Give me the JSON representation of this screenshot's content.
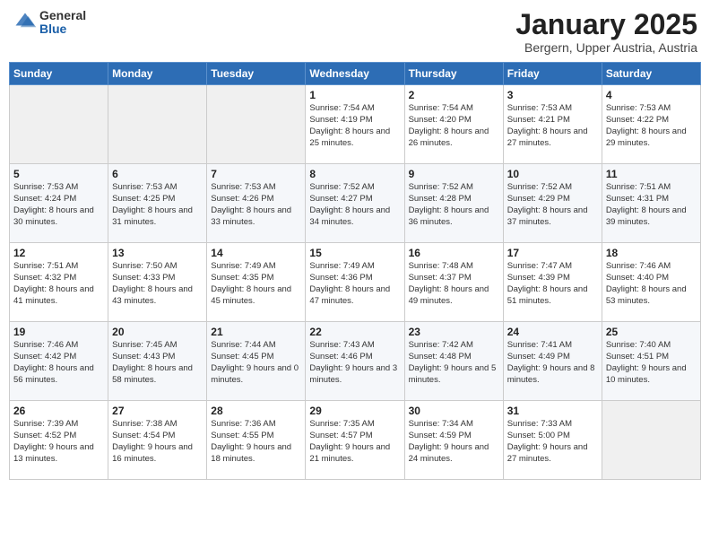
{
  "logo": {
    "general": "General",
    "blue": "Blue"
  },
  "title": "January 2025",
  "subtitle": "Bergern, Upper Austria, Austria",
  "days_header": [
    "Sunday",
    "Monday",
    "Tuesday",
    "Wednesday",
    "Thursday",
    "Friday",
    "Saturday"
  ],
  "weeks": [
    [
      {
        "day": "",
        "empty": true
      },
      {
        "day": "",
        "empty": true
      },
      {
        "day": "",
        "empty": true
      },
      {
        "day": "1",
        "sunrise": "7:54 AM",
        "sunset": "4:19 PM",
        "daylight": "8 hours and 25 minutes."
      },
      {
        "day": "2",
        "sunrise": "7:54 AM",
        "sunset": "4:20 PM",
        "daylight": "8 hours and 26 minutes."
      },
      {
        "day": "3",
        "sunrise": "7:53 AM",
        "sunset": "4:21 PM",
        "daylight": "8 hours and 27 minutes."
      },
      {
        "day": "4",
        "sunrise": "7:53 AM",
        "sunset": "4:22 PM",
        "daylight": "8 hours and 29 minutes."
      }
    ],
    [
      {
        "day": "5",
        "sunrise": "7:53 AM",
        "sunset": "4:24 PM",
        "daylight": "8 hours and 30 minutes."
      },
      {
        "day": "6",
        "sunrise": "7:53 AM",
        "sunset": "4:25 PM",
        "daylight": "8 hours and 31 minutes."
      },
      {
        "day": "7",
        "sunrise": "7:53 AM",
        "sunset": "4:26 PM",
        "daylight": "8 hours and 33 minutes."
      },
      {
        "day": "8",
        "sunrise": "7:52 AM",
        "sunset": "4:27 PM",
        "daylight": "8 hours and 34 minutes."
      },
      {
        "day": "9",
        "sunrise": "7:52 AM",
        "sunset": "4:28 PM",
        "daylight": "8 hours and 36 minutes."
      },
      {
        "day": "10",
        "sunrise": "7:52 AM",
        "sunset": "4:29 PM",
        "daylight": "8 hours and 37 minutes."
      },
      {
        "day": "11",
        "sunrise": "7:51 AM",
        "sunset": "4:31 PM",
        "daylight": "8 hours and 39 minutes."
      }
    ],
    [
      {
        "day": "12",
        "sunrise": "7:51 AM",
        "sunset": "4:32 PM",
        "daylight": "8 hours and 41 minutes."
      },
      {
        "day": "13",
        "sunrise": "7:50 AM",
        "sunset": "4:33 PM",
        "daylight": "8 hours and 43 minutes."
      },
      {
        "day": "14",
        "sunrise": "7:49 AM",
        "sunset": "4:35 PM",
        "daylight": "8 hours and 45 minutes."
      },
      {
        "day": "15",
        "sunrise": "7:49 AM",
        "sunset": "4:36 PM",
        "daylight": "8 hours and 47 minutes."
      },
      {
        "day": "16",
        "sunrise": "7:48 AM",
        "sunset": "4:37 PM",
        "daylight": "8 hours and 49 minutes."
      },
      {
        "day": "17",
        "sunrise": "7:47 AM",
        "sunset": "4:39 PM",
        "daylight": "8 hours and 51 minutes."
      },
      {
        "day": "18",
        "sunrise": "7:46 AM",
        "sunset": "4:40 PM",
        "daylight": "8 hours and 53 minutes."
      }
    ],
    [
      {
        "day": "19",
        "sunrise": "7:46 AM",
        "sunset": "4:42 PM",
        "daylight": "8 hours and 56 minutes."
      },
      {
        "day": "20",
        "sunrise": "7:45 AM",
        "sunset": "4:43 PM",
        "daylight": "8 hours and 58 minutes."
      },
      {
        "day": "21",
        "sunrise": "7:44 AM",
        "sunset": "4:45 PM",
        "daylight": "9 hours and 0 minutes."
      },
      {
        "day": "22",
        "sunrise": "7:43 AM",
        "sunset": "4:46 PM",
        "daylight": "9 hours and 3 minutes."
      },
      {
        "day": "23",
        "sunrise": "7:42 AM",
        "sunset": "4:48 PM",
        "daylight": "9 hours and 5 minutes."
      },
      {
        "day": "24",
        "sunrise": "7:41 AM",
        "sunset": "4:49 PM",
        "daylight": "9 hours and 8 minutes."
      },
      {
        "day": "25",
        "sunrise": "7:40 AM",
        "sunset": "4:51 PM",
        "daylight": "9 hours and 10 minutes."
      }
    ],
    [
      {
        "day": "26",
        "sunrise": "7:39 AM",
        "sunset": "4:52 PM",
        "daylight": "9 hours and 13 minutes."
      },
      {
        "day": "27",
        "sunrise": "7:38 AM",
        "sunset": "4:54 PM",
        "daylight": "9 hours and 16 minutes."
      },
      {
        "day": "28",
        "sunrise": "7:36 AM",
        "sunset": "4:55 PM",
        "daylight": "9 hours and 18 minutes."
      },
      {
        "day": "29",
        "sunrise": "7:35 AM",
        "sunset": "4:57 PM",
        "daylight": "9 hours and 21 minutes."
      },
      {
        "day": "30",
        "sunrise": "7:34 AM",
        "sunset": "4:59 PM",
        "daylight": "9 hours and 24 minutes."
      },
      {
        "day": "31",
        "sunrise": "7:33 AM",
        "sunset": "5:00 PM",
        "daylight": "9 hours and 27 minutes."
      },
      {
        "day": "",
        "empty": true
      }
    ]
  ],
  "labels": {
    "sunrise": "Sunrise:",
    "sunset": "Sunset:",
    "daylight": "Daylight:"
  }
}
